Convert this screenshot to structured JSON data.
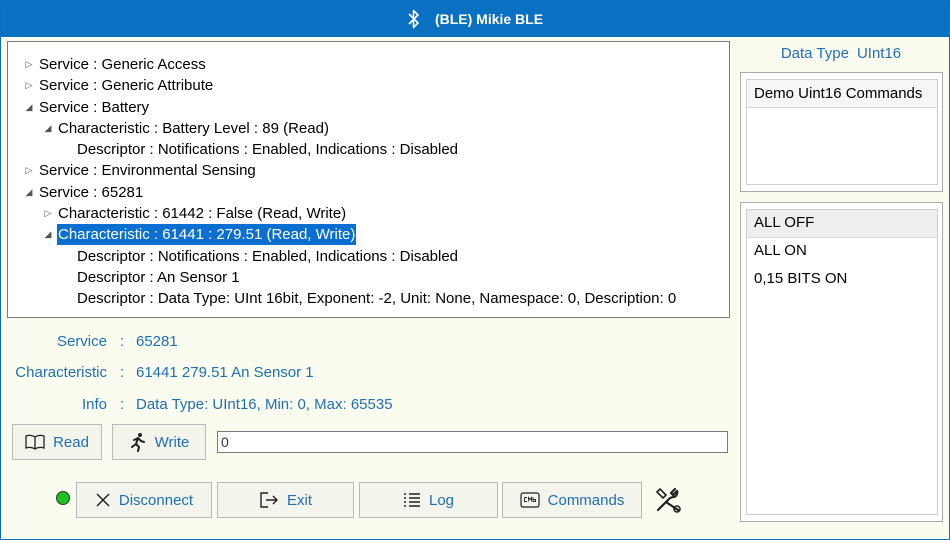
{
  "window": {
    "title": "(BLE) Mikie BLE"
  },
  "tree": [
    {
      "indent": 0,
      "state": "collapsed",
      "text": "Service : Generic Access",
      "selected": false
    },
    {
      "indent": 0,
      "state": "collapsed",
      "text": "Service : Generic Attribute",
      "selected": false
    },
    {
      "indent": 0,
      "state": "expanded",
      "text": "Service : Battery",
      "selected": false
    },
    {
      "indent": 1,
      "state": "expanded",
      "text": "Characteristic : Battery Level : 89 (Read)",
      "selected": false
    },
    {
      "indent": 2,
      "state": "leaf",
      "text": "Descriptor : Notifications : Enabled, Indications : Disabled",
      "selected": false
    },
    {
      "indent": 0,
      "state": "collapsed",
      "text": "Service : Environmental Sensing",
      "selected": false
    },
    {
      "indent": 0,
      "state": "expanded",
      "text": "Service : 65281",
      "selected": false
    },
    {
      "indent": 1,
      "state": "collapsed",
      "text": "Characteristic : 61442 : False (Read, Write)",
      "selected": false
    },
    {
      "indent": 1,
      "state": "expanded",
      "text": "Characteristic : 61441 : 279.51 (Read, Write)",
      "selected": true
    },
    {
      "indent": 2,
      "state": "leaf",
      "text": "Descriptor : Notifications : Enabled, Indications : Disabled",
      "selected": false
    },
    {
      "indent": 2,
      "state": "leaf",
      "text": "Descriptor : An Sensor 1",
      "selected": false
    },
    {
      "indent": 2,
      "state": "leaf",
      "text": "Descriptor : Data Type: UInt 16bit,  Exponent: -2,  Unit: None,  Namespace: 0,  Description: 0",
      "selected": false
    }
  ],
  "info": {
    "colon": ":",
    "service": {
      "label": "Service",
      "value": "65281"
    },
    "characteristic": {
      "label": "Characteristic",
      "value": "61441  279.51  An Sensor 1"
    },
    "info": {
      "label": "Info",
      "value": "Data Type: UInt16,  Min: 0,  Max: 65535"
    }
  },
  "actions": {
    "read_label": "Read",
    "write_label": "Write",
    "write_value": "0"
  },
  "bottom": {
    "disconnect_label": "Disconnect",
    "exit_label": "Exit",
    "log_label": "Log",
    "commands_label": "Commands"
  },
  "right": {
    "data_type_label": "Data Type",
    "data_type_value": "UInt16",
    "commands_header": "Demo Uint16 Commands",
    "commands": [
      "ALL OFF",
      "ALL ON",
      "0,15 BITS ON"
    ]
  },
  "colors": {
    "accent": "#0a70c2",
    "selection": "#0b6fd1",
    "label_blue": "#1f6fb3",
    "status_connected": "#1ec21e"
  },
  "icons": {
    "title": "bluetooth-icon",
    "read": "book-icon",
    "write": "running-man-icon",
    "disconnect": "close-icon",
    "exit": "exit-icon",
    "log": "list-icon",
    "commands": "cmd-icon",
    "tools": "tools-icon"
  }
}
